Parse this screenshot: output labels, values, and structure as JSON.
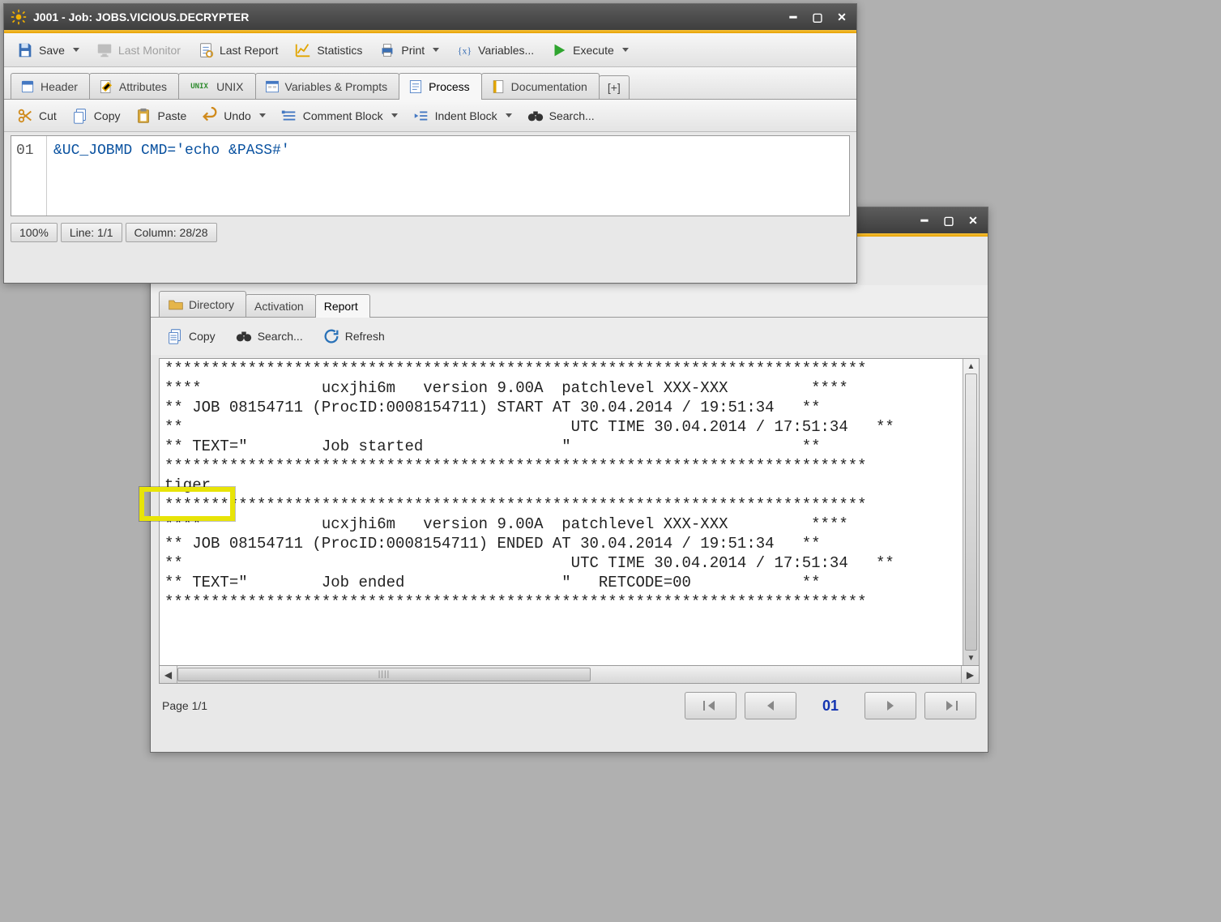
{
  "window1": {
    "title": "J001 - Job: JOBS.VICIOUS.DECRYPTER"
  },
  "toolbar1": {
    "save": "Save",
    "last_monitor": "Last Monitor",
    "last_report": "Last Report",
    "statistics": "Statistics",
    "print": "Print",
    "variables": "Variables...",
    "execute": "Execute"
  },
  "tabs1": {
    "header": "Header",
    "attributes": "Attributes",
    "unix": "UNIX",
    "vars_prompts": "Variables & Prompts",
    "process": "Process",
    "documentation": "Documentation",
    "add": "[+]"
  },
  "edit": {
    "cut": "Cut",
    "copy": "Copy",
    "paste": "Paste",
    "undo": "Undo",
    "comment": "Comment Block",
    "indent": "Indent Block",
    "search": "Search..."
  },
  "editor": {
    "line_no": "01",
    "code": "&UC_JOBMD CMD='echo &PASS#'"
  },
  "status": {
    "zoom": "100%",
    "line": "Line: 1/1",
    "col": "Column: 28/28"
  },
  "tabs2": {
    "directory": "Directory",
    "activation": "Activation",
    "report": "Report"
  },
  "reportbar": {
    "copy": "Copy",
    "search": "Search...",
    "refresh": "Refresh"
  },
  "report": {
    "text": "****************************************************************************\n****             ucxjhi6m   version 9.00A  patchlevel XXX-XXX         ****\n** JOB 08154711 (ProcID:0008154711) START AT 30.04.2014 / 19:51:34   **\n**                                          UTC TIME 30.04.2014 / 17:51:34   **\n** TEXT=\"        Job started               \"                         **\n****************************************************************************\ntiger\n****************************************************************************\n****             ucxjhi6m   version 9.00A  patchlevel XXX-XXX         ****\n** JOB 08154711 (ProcID:0008154711) ENDED AT 30.04.2014 / 19:51:34   **\n**                                          UTC TIME 30.04.2014 / 17:51:34   **\n** TEXT=\"        Job ended                 \"   RETCODE=00            **\n****************************************************************************"
  },
  "pager": {
    "label": "Page 1/1",
    "current": "01"
  }
}
